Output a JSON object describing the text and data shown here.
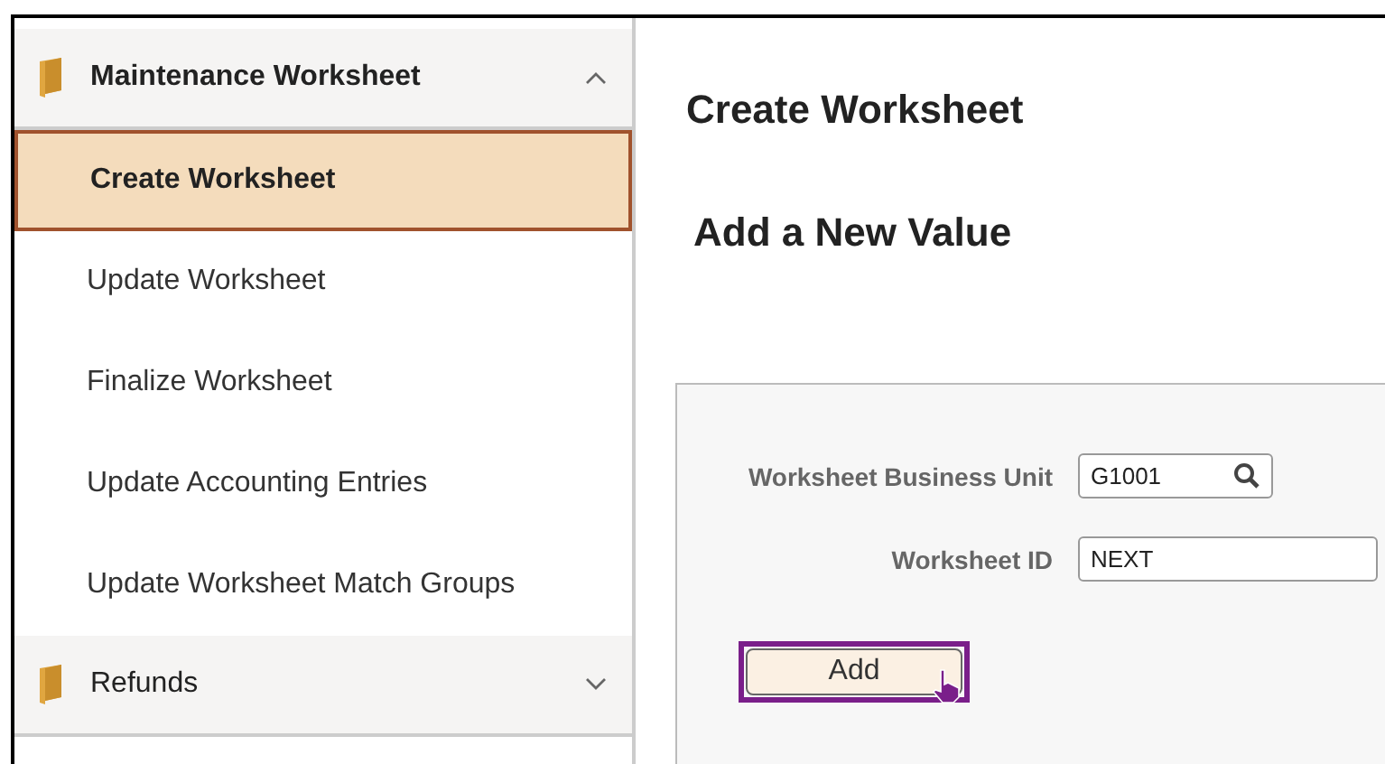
{
  "sidebar": {
    "groups": [
      {
        "label": "Maintenance Worksheet",
        "expanded": true,
        "items": [
          {
            "label": "Create Worksheet",
            "selected": true
          },
          {
            "label": "Update Worksheet",
            "selected": false
          },
          {
            "label": "Finalize Worksheet",
            "selected": false
          },
          {
            "label": "Update Accounting Entries",
            "selected": false
          },
          {
            "label": "Update Worksheet Match Groups",
            "selected": false
          }
        ]
      },
      {
        "label": "Refunds",
        "expanded": false
      }
    ]
  },
  "page": {
    "title": "Create Worksheet",
    "subtitle": "Add a New Value",
    "fields": [
      {
        "kind": "lookup",
        "label": "Worksheet Business Unit",
        "value": "G1001"
      },
      {
        "kind": "text",
        "label": "Worksheet ID",
        "value": "NEXT"
      }
    ],
    "add_button": {
      "label": "Add",
      "focused": true
    }
  }
}
